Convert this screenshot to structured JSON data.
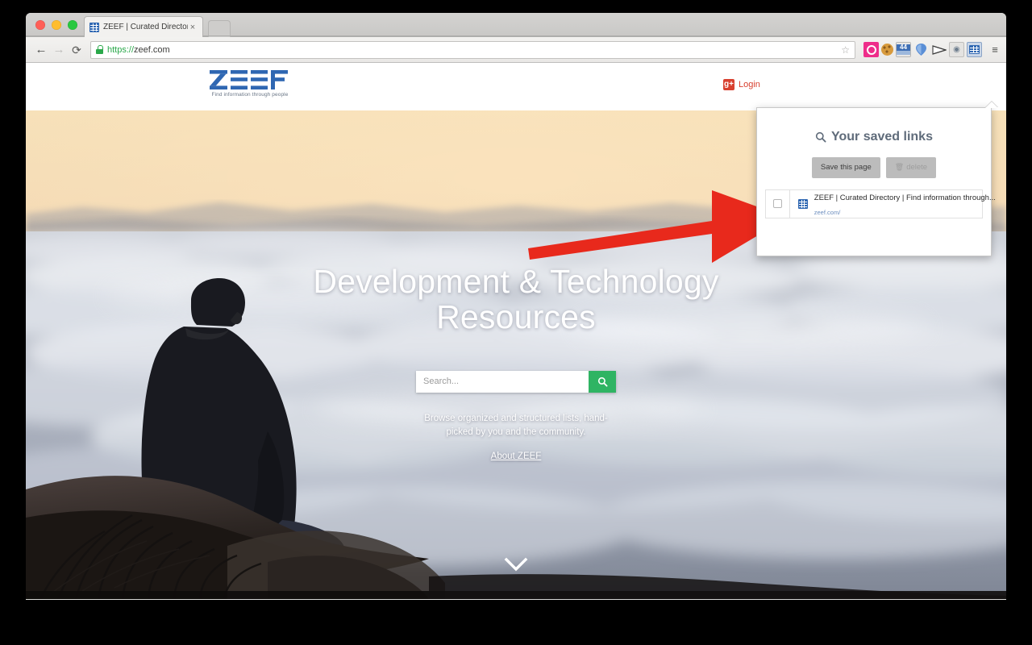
{
  "browser": {
    "tab": {
      "title": "ZEEF | Curated Directory | ",
      "close_label": "×",
      "favicon": "zeef-grid-favicon"
    },
    "new_tab_label": "",
    "nav": {
      "back": "←",
      "forward": "→",
      "reload": "⟳"
    },
    "omnibox": {
      "scheme": "https://",
      "host": "zeef.com",
      "full_url": "https://zeef.com",
      "lock_icon": "secure-lock-icon",
      "star_icon": "☆"
    },
    "extensions": [
      {
        "name": "camera-extension-icon",
        "label": ""
      },
      {
        "name": "cookie-extension-icon",
        "label": ""
      },
      {
        "name": "44-extension-icon",
        "label": "44"
      },
      {
        "name": "pin-extension-icon",
        "label": ""
      },
      {
        "name": "flag-extension-icon",
        "label": ""
      },
      {
        "name": "globe-extension-icon",
        "label": ""
      },
      {
        "name": "saved-links-extension-icon",
        "label": ""
      }
    ],
    "menu_icon": "≡"
  },
  "site": {
    "logo": {
      "wordmark": "ZEEF",
      "tagline": "Find information through people"
    },
    "login": {
      "icon_label": "g+",
      "label": "Login"
    },
    "hero": {
      "title_line1": "Development & Technology",
      "title_line2": "Resources",
      "search_placeholder": "Search...",
      "search_value": "",
      "search_button_icon": "🔍",
      "subtitle": "Browse organized and structured lists, hand-picked by you and the community.",
      "about_link": "About ZEEF",
      "scroll_indicator": "chevron-down-icon"
    }
  },
  "popup": {
    "title": "Your saved links",
    "search_icon": "🔍",
    "save_button": "Save this page",
    "delete_button": "delete",
    "trash_icon": "🗑",
    "items": [
      {
        "title": "ZEEF | Curated Directory | Find information through...",
        "url": "zeef.com/",
        "checked": false
      }
    ]
  },
  "annotation": {
    "arrow": "red-right-arrow",
    "color": "#e8291c"
  },
  "colors": {
    "brand_blue": "#2f67b2",
    "search_green": "#2fb463",
    "login_red": "#d8402f",
    "annotation_red": "#e8291c",
    "popup_title": "#5f6b7a"
  }
}
